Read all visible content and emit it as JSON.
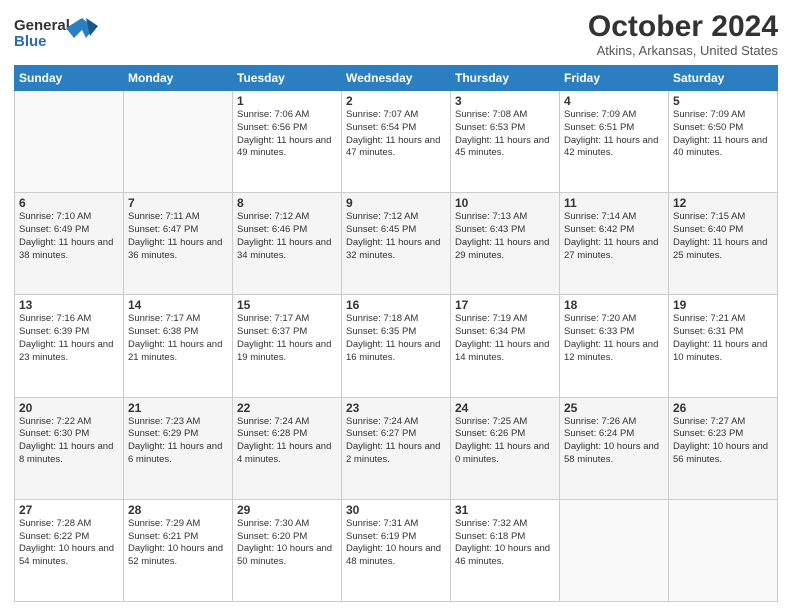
{
  "logo": {
    "line1": "General",
    "line2": "Blue"
  },
  "title": "October 2024",
  "subtitle": "Atkins, Arkansas, United States",
  "days_header": [
    "Sunday",
    "Monday",
    "Tuesday",
    "Wednesday",
    "Thursday",
    "Friday",
    "Saturday"
  ],
  "weeks": [
    [
      {
        "num": "",
        "info": ""
      },
      {
        "num": "",
        "info": ""
      },
      {
        "num": "1",
        "info": "Sunrise: 7:06 AM\nSunset: 6:56 PM\nDaylight: 11 hours and 49 minutes."
      },
      {
        "num": "2",
        "info": "Sunrise: 7:07 AM\nSunset: 6:54 PM\nDaylight: 11 hours and 47 minutes."
      },
      {
        "num": "3",
        "info": "Sunrise: 7:08 AM\nSunset: 6:53 PM\nDaylight: 11 hours and 45 minutes."
      },
      {
        "num": "4",
        "info": "Sunrise: 7:09 AM\nSunset: 6:51 PM\nDaylight: 11 hours and 42 minutes."
      },
      {
        "num": "5",
        "info": "Sunrise: 7:09 AM\nSunset: 6:50 PM\nDaylight: 11 hours and 40 minutes."
      }
    ],
    [
      {
        "num": "6",
        "info": "Sunrise: 7:10 AM\nSunset: 6:49 PM\nDaylight: 11 hours and 38 minutes."
      },
      {
        "num": "7",
        "info": "Sunrise: 7:11 AM\nSunset: 6:47 PM\nDaylight: 11 hours and 36 minutes."
      },
      {
        "num": "8",
        "info": "Sunrise: 7:12 AM\nSunset: 6:46 PM\nDaylight: 11 hours and 34 minutes."
      },
      {
        "num": "9",
        "info": "Sunrise: 7:12 AM\nSunset: 6:45 PM\nDaylight: 11 hours and 32 minutes."
      },
      {
        "num": "10",
        "info": "Sunrise: 7:13 AM\nSunset: 6:43 PM\nDaylight: 11 hours and 29 minutes."
      },
      {
        "num": "11",
        "info": "Sunrise: 7:14 AM\nSunset: 6:42 PM\nDaylight: 11 hours and 27 minutes."
      },
      {
        "num": "12",
        "info": "Sunrise: 7:15 AM\nSunset: 6:40 PM\nDaylight: 11 hours and 25 minutes."
      }
    ],
    [
      {
        "num": "13",
        "info": "Sunrise: 7:16 AM\nSunset: 6:39 PM\nDaylight: 11 hours and 23 minutes."
      },
      {
        "num": "14",
        "info": "Sunrise: 7:17 AM\nSunset: 6:38 PM\nDaylight: 11 hours and 21 minutes."
      },
      {
        "num": "15",
        "info": "Sunrise: 7:17 AM\nSunset: 6:37 PM\nDaylight: 11 hours and 19 minutes."
      },
      {
        "num": "16",
        "info": "Sunrise: 7:18 AM\nSunset: 6:35 PM\nDaylight: 11 hours and 16 minutes."
      },
      {
        "num": "17",
        "info": "Sunrise: 7:19 AM\nSunset: 6:34 PM\nDaylight: 11 hours and 14 minutes."
      },
      {
        "num": "18",
        "info": "Sunrise: 7:20 AM\nSunset: 6:33 PM\nDaylight: 11 hours and 12 minutes."
      },
      {
        "num": "19",
        "info": "Sunrise: 7:21 AM\nSunset: 6:31 PM\nDaylight: 11 hours and 10 minutes."
      }
    ],
    [
      {
        "num": "20",
        "info": "Sunrise: 7:22 AM\nSunset: 6:30 PM\nDaylight: 11 hours and 8 minutes."
      },
      {
        "num": "21",
        "info": "Sunrise: 7:23 AM\nSunset: 6:29 PM\nDaylight: 11 hours and 6 minutes."
      },
      {
        "num": "22",
        "info": "Sunrise: 7:24 AM\nSunset: 6:28 PM\nDaylight: 11 hours and 4 minutes."
      },
      {
        "num": "23",
        "info": "Sunrise: 7:24 AM\nSunset: 6:27 PM\nDaylight: 11 hours and 2 minutes."
      },
      {
        "num": "24",
        "info": "Sunrise: 7:25 AM\nSunset: 6:26 PM\nDaylight: 11 hours and 0 minutes."
      },
      {
        "num": "25",
        "info": "Sunrise: 7:26 AM\nSunset: 6:24 PM\nDaylight: 10 hours and 58 minutes."
      },
      {
        "num": "26",
        "info": "Sunrise: 7:27 AM\nSunset: 6:23 PM\nDaylight: 10 hours and 56 minutes."
      }
    ],
    [
      {
        "num": "27",
        "info": "Sunrise: 7:28 AM\nSunset: 6:22 PM\nDaylight: 10 hours and 54 minutes."
      },
      {
        "num": "28",
        "info": "Sunrise: 7:29 AM\nSunset: 6:21 PM\nDaylight: 10 hours and 52 minutes."
      },
      {
        "num": "29",
        "info": "Sunrise: 7:30 AM\nSunset: 6:20 PM\nDaylight: 10 hours and 50 minutes."
      },
      {
        "num": "30",
        "info": "Sunrise: 7:31 AM\nSunset: 6:19 PM\nDaylight: 10 hours and 48 minutes."
      },
      {
        "num": "31",
        "info": "Sunrise: 7:32 AM\nSunset: 6:18 PM\nDaylight: 10 hours and 46 minutes."
      },
      {
        "num": "",
        "info": ""
      },
      {
        "num": "",
        "info": ""
      }
    ]
  ]
}
